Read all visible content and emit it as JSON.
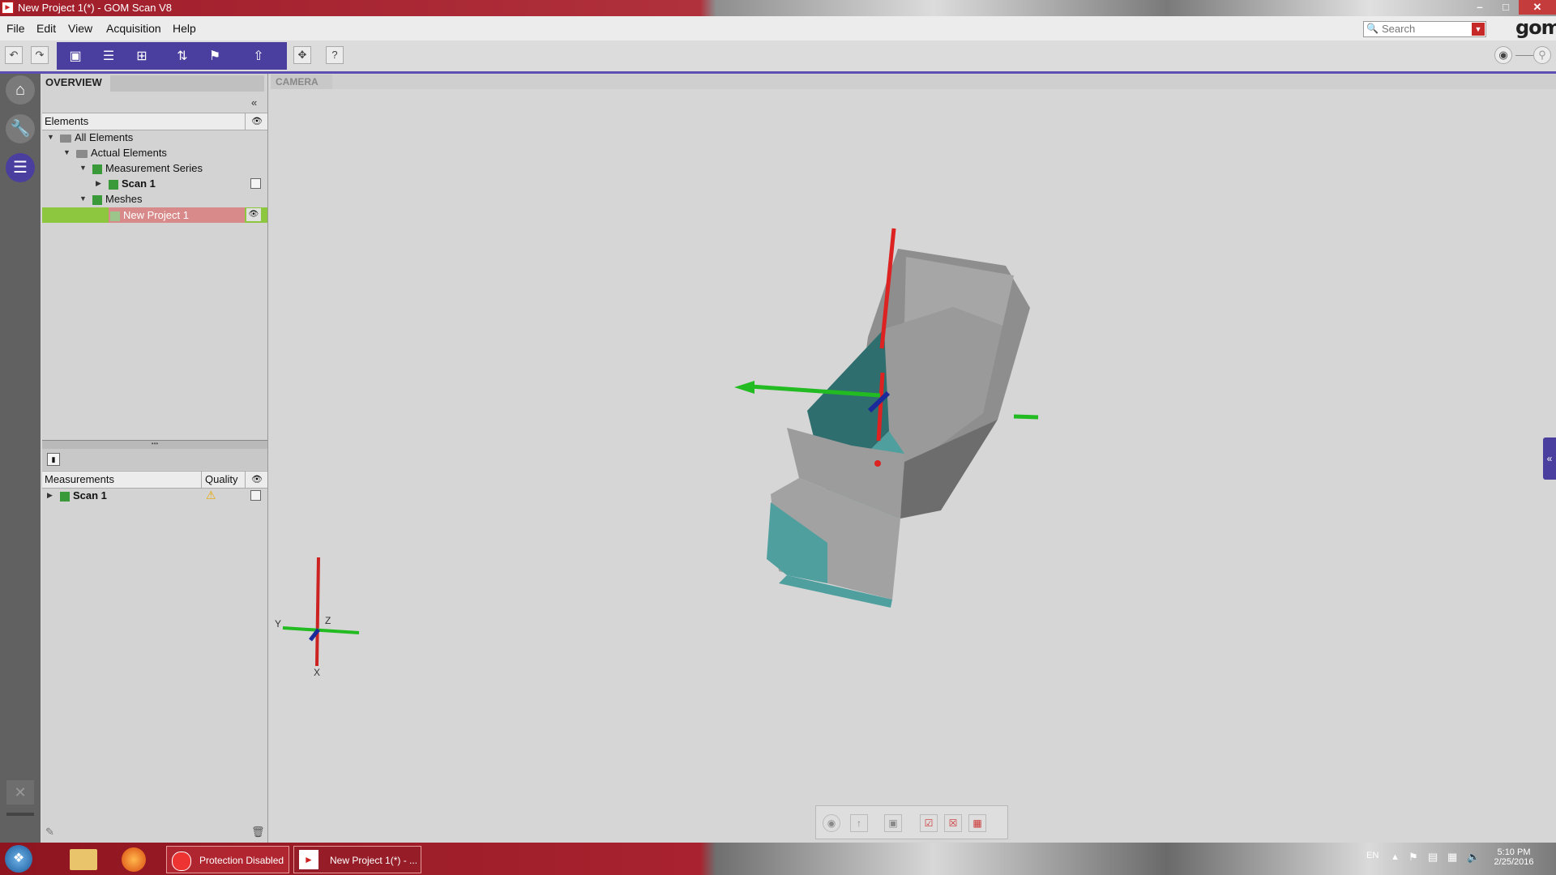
{
  "window": {
    "title": "New Project 1(*) - GOM Scan V8",
    "minimize": "–",
    "restore": "□",
    "close": "✕"
  },
  "menu": [
    "File",
    "Edit",
    "View",
    "Acquisition",
    "Help"
  ],
  "search": {
    "placeholder": "Search"
  },
  "logo": "gom",
  "toolbar": {
    "undo": "↶",
    "redo": "↷",
    "help": "?"
  },
  "panel": {
    "tab": "OVERVIEW",
    "collapse": "«",
    "elements_header": "Elements",
    "tree": [
      "All Elements",
      "Actual Elements",
      "Measurement Series",
      "Scan 1",
      "Meshes",
      "New Project 1"
    ],
    "measurements_header": "Measurements",
    "quality_header": "Quality",
    "measurements": [
      "Scan 1"
    ]
  },
  "viewport": {
    "camera_tab": "CAMERA",
    "triad": {
      "y": "Y",
      "z": "Z",
      "x": "X"
    }
  },
  "taskbar": {
    "protection": "Protection Disabled",
    "project": "New Project 1(*) - ...",
    "lang": "EN",
    "time": "5:10 PM",
    "date": "2/25/2016"
  },
  "icons": [
    "home-icon",
    "wrench-icon",
    "scan-icon",
    "eye-icon",
    "warning-icon",
    "trash-icon",
    "edit-icon"
  ],
  "colors": {
    "accent": "#4a3f9e",
    "selection": "#d88a8a",
    "selection_green": "#8dc63f",
    "title_red": "#a01d2a"
  }
}
